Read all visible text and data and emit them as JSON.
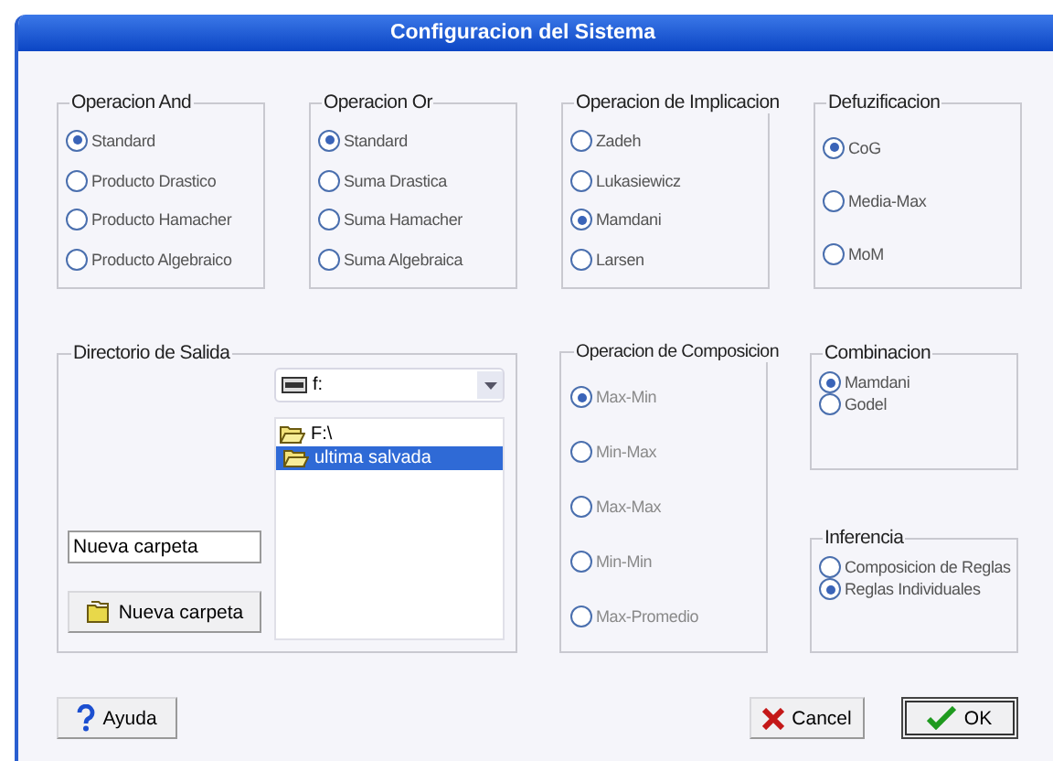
{
  "window": {
    "title": "Configuracion del Sistema"
  },
  "option_groups": [
    {
      "title": "Operacion And",
      "disabled": false,
      "options": [
        {
          "label": "Standard",
          "selected": true
        },
        {
          "label": "Producto Drastico",
          "selected": false
        },
        {
          "label": "Producto Hamacher",
          "selected": false
        },
        {
          "label": "Producto Algebraico",
          "selected": false
        }
      ]
    },
    {
      "title": "Operacion Or",
      "disabled": false,
      "options": [
        {
          "label": "Standard",
          "selected": true
        },
        {
          "label": "Suma Drastica",
          "selected": false
        },
        {
          "label": "Suma Hamacher",
          "selected": false
        },
        {
          "label": "Suma Algebraica",
          "selected": false
        }
      ]
    },
    {
      "title": "Operacion de Implicacion",
      "disabled": false,
      "options": [
        {
          "label": "Zadeh",
          "selected": false
        },
        {
          "label": "Lukasiewicz",
          "selected": false
        },
        {
          "label": "Mamdani",
          "selected": true
        },
        {
          "label": "Larsen",
          "selected": false
        }
      ]
    },
    {
      "title": "Defuzificacion",
      "disabled": false,
      "options": [
        {
          "label": "CoG",
          "selected": true
        },
        {
          "label": "Media-Max",
          "selected": false
        },
        {
          "label": "MoM",
          "selected": false
        }
      ]
    },
    {
      "title": "Operacion de Composicion",
      "disabled": true,
      "options": [
        {
          "label": "Max-Min",
          "selected": true
        },
        {
          "label": "Min-Max",
          "selected": false
        },
        {
          "label": "Max-Max",
          "selected": false
        },
        {
          "label": "Min-Min",
          "selected": false
        },
        {
          "label": "Max-Promedio",
          "selected": false
        }
      ]
    },
    {
      "title": "Combinacion",
      "disabled": false,
      "options": [
        {
          "label": "Mamdani",
          "selected": true
        },
        {
          "label": "Godel",
          "selected": false
        }
      ]
    },
    {
      "title": "Inferencia",
      "disabled": false,
      "options": [
        {
          "label": "Composicion de Reglas",
          "selected": false
        },
        {
          "label": "Reglas Individuales",
          "selected": true
        }
      ]
    }
  ],
  "output_directory": {
    "title": "Directorio de Salida",
    "drive": "f:",
    "folders": [
      {
        "label": "F:\\",
        "selected": false,
        "children": [
          {
            "label": "ultima salvada",
            "selected": true
          }
        ]
      }
    ],
    "new_folder_field": {
      "value": "Nueva carpeta"
    },
    "new_folder_button": "Nueva carpeta"
  },
  "buttons": [
    {
      "label": "Ayuda",
      "kind": "help",
      "default": false
    },
    {
      "label": "Cancel",
      "kind": "cancel",
      "default": false
    },
    {
      "label": "OK",
      "kind": "ok",
      "default": true
    }
  ]
}
